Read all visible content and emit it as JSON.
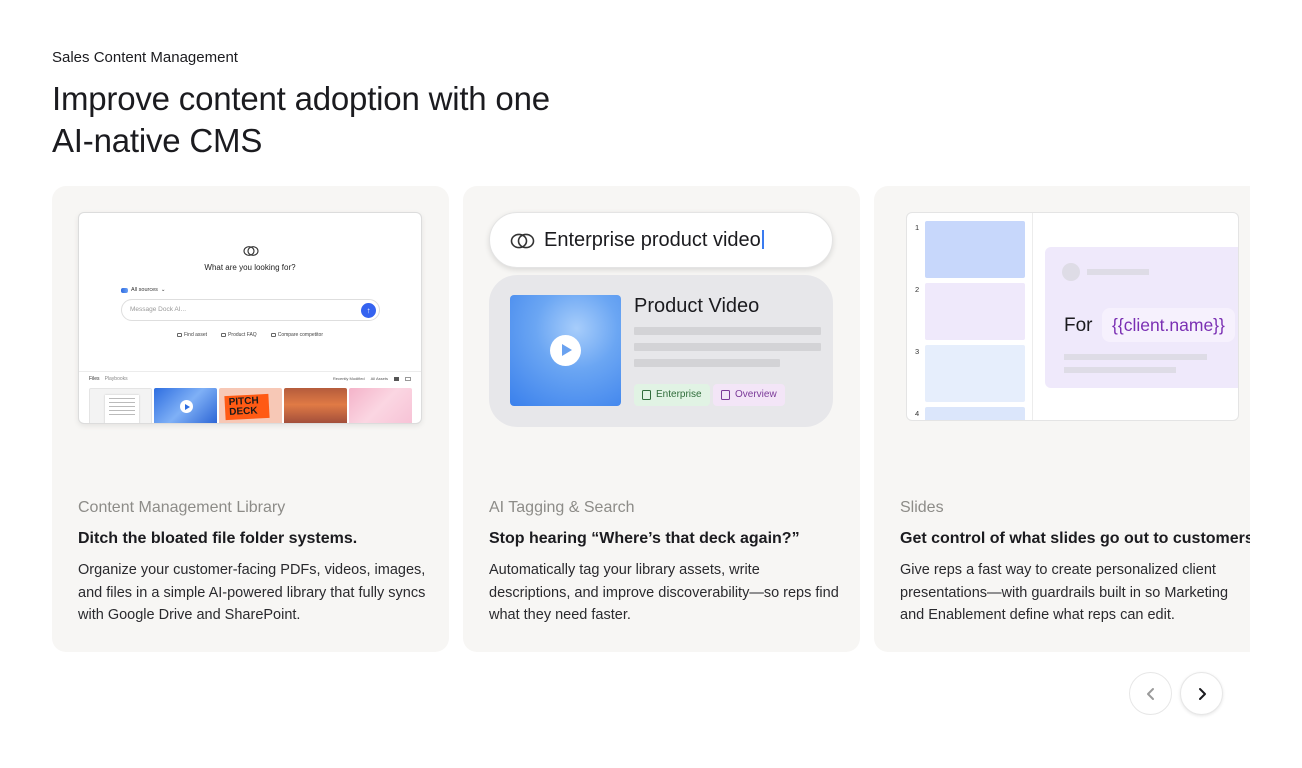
{
  "section": {
    "eyebrow": "Sales Content Management",
    "headline": "Improve content adoption with one AI-native CMS"
  },
  "cards": [
    {
      "category": "Content Management Library",
      "title": "Ditch the bloated file folder systems.",
      "description": "Organize your customer-facing PDFs, videos, images, and files in a simple AI-powered library that fully syncs with Google Drive and SharePoint.",
      "mockup": {
        "prompt": "What are you looking for?",
        "sources": "All sources",
        "placeholder": "Message Dock AI...",
        "chips": [
          "Find asset",
          "Product FAQ",
          "Compare competitor"
        ],
        "tabs": [
          "Files",
          "Playbooks"
        ],
        "sort": "Recently Modified",
        "filter": "All Assets",
        "thumb_text": "PITCH DECK"
      }
    },
    {
      "category": "AI Tagging & Search",
      "title": "Stop hearing “Where’s that deck again?”",
      "description": "Automatically tag your library assets, write descriptions, and improve discoverability—so reps find what they need faster.",
      "mockup": {
        "query": "Enterprise product video",
        "result_title": "Product Video",
        "tags": [
          "Enterprise",
          "Overview"
        ]
      }
    },
    {
      "category": "Slides",
      "title": "Get control of what slides go out to customers.",
      "description": "Give reps a fast way to create personalized client presentations—with guardrails built in so Marketing and Enablement define what reps can edit.",
      "mockup": {
        "slide_numbers": [
          "1",
          "2",
          "3",
          "4"
        ],
        "for_label": "For",
        "token": "{{client.name}}"
      }
    }
  ],
  "nav": {
    "prev_icon": "chevron-left-icon",
    "next_icon": "chevron-right-icon"
  },
  "colors": {
    "card_bg": "#f7f6f4",
    "accent_blue": "#3563f0",
    "token_purple": "#7a2fb3",
    "tag_green_bg": "#e1f3e4",
    "tag_purple_bg": "#f3e5f7"
  }
}
